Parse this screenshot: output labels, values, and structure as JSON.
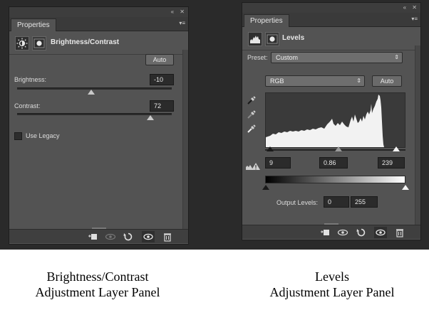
{
  "left_panel": {
    "tab_label": "Properties",
    "strip_collapse": "«",
    "strip_close": "✕",
    "menu": "▾≡",
    "header_title": "Brightness/Contrast",
    "auto_label": "Auto",
    "brightness_label": "Brightness:",
    "brightness_value": "-10",
    "brightness_level": 0.48,
    "contrast_label": "Contrast:",
    "contrast_value": "72",
    "contrast_level": 0.86,
    "use_legacy_label": "Use Legacy",
    "use_legacy_checked": false
  },
  "right_panel": {
    "tab_label": "Properties",
    "strip_collapse": "«",
    "strip_close": "✕",
    "menu": "▾≡",
    "header_title": "Levels",
    "preset_label": "Preset:",
    "preset_value": "Custom",
    "channel_value": "RGB",
    "auto_label": "Auto",
    "input_black": "9",
    "input_gamma": "0.86",
    "input_white": "239",
    "output_label": "Output Levels:",
    "output_black": "0",
    "output_white": "255"
  },
  "captions": {
    "left_line1": "Brightness/Contrast",
    "left_line2": "Adjustment Layer Panel",
    "right_line1": "Levels",
    "right_line2": "Adjustment Layer Panel"
  },
  "colors": {
    "panel_bg": "#535353",
    "dark_bg": "#2a2a2a",
    "histogram_fill": "#f2f2f2"
  },
  "icons": [
    "adjustment-icon",
    "mask-icon",
    "levels-icon",
    "eyedropper-icon",
    "clip-icon",
    "visibility-icon",
    "reset-icon",
    "eye-icon",
    "trash-icon"
  ]
}
